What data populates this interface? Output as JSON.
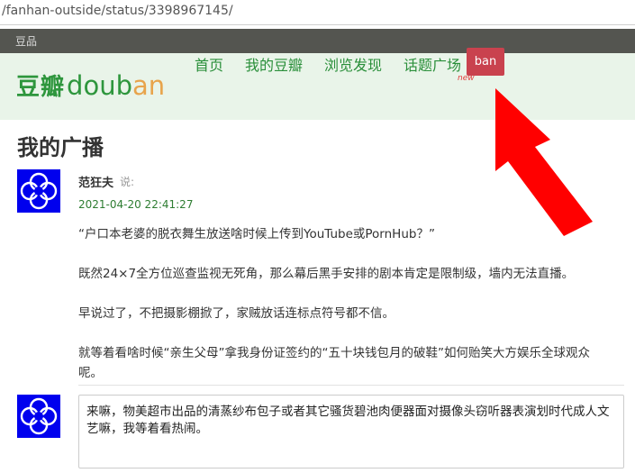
{
  "browser": {
    "url": "/fanhan-outside/status/3398967145/"
  },
  "top_bar": {
    "link": "豆品"
  },
  "header": {
    "logo_cn": "豆瓣",
    "logo_en": "douban",
    "nav": [
      {
        "label": "首页"
      },
      {
        "label": "我的豆瓣"
      },
      {
        "label": "浏览发现"
      },
      {
        "label": "话题广场"
      }
    ],
    "new_tag": "new"
  },
  "annotation": {
    "badge_text": "ban",
    "badge_color": "#c9424e",
    "arrow_color": "#ff0000"
  },
  "page": {
    "title": "我的广播"
  },
  "status": {
    "author": "范狂夫",
    "said": "说:",
    "timestamp": "2021-04-20 22:41:27",
    "paragraphs": [
      "“户口本老婆的脱衣舞生放送啥时候上传到YouTube或PornHub？”",
      "既然24×7全方位巡查监视无死角，那么幕后黑手安排的剧本肯定是限制级，墙内无法直播。",
      "早说过了，不把摄影棚掀了，家贼放话连标点符号都不信。",
      "就等着看啥时候“亲生父母”拿我身份证签约的“五十块钱包月的破鞋”如何贻笑大方娱乐全球观众呢。"
    ]
  },
  "comment": {
    "text": "来嘛，物美超市出品的清蒸纱布包子或者其它骚货碧池肉便器面对摄像头窃听器表演划时代成人文艺嘛，我等着看热闹。"
  },
  "colors": {
    "brand_green": "#2e963d",
    "header_bg": "#e9f4e9",
    "top_bar_bg": "#545550",
    "avatar_bg": "#0000ee"
  }
}
